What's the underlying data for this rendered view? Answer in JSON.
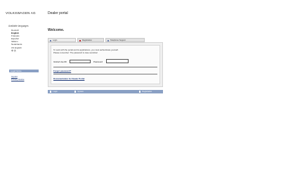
{
  "header": {
    "brand": "VOLKSWAGEN AG",
    "page_title": "Dealer portal",
    "welcome": "Welcome."
  },
  "sidebar": {
    "languages_title": "Available languages",
    "languages": [
      {
        "label": "Deutsch",
        "selected": false
      },
      {
        "label": "English",
        "selected": true
      },
      {
        "label": "Français",
        "selected": false
      },
      {
        "label": "Español",
        "selected": false
      },
      {
        "label": "Italiano",
        "selected": false
      },
      {
        "label": "Nederlands",
        "selected": false
      },
      {
        "label": "US English",
        "selected": false
      }
    ],
    "language_extra": "中 文",
    "box_title": "Legal Notice",
    "links": [
      "Imprint",
      "Privacy Notice"
    ]
  },
  "tabs": [
    {
      "label": "Login",
      "active": true,
      "dot_color": "#6a7fb0"
    },
    {
      "label": "Registration",
      "active": false,
      "dot_color": "#c0272d"
    },
    {
      "label": "Telephone Support",
      "active": false,
      "dot_color": "#6a7fb0"
    }
  ],
  "login": {
    "message_line1": "To work with the portal and its applications, you must authenticate yourself.",
    "message_line2": "Please remember: The password is case sensitive!",
    "userid_label": "Global UserID",
    "userid_value": "",
    "password_label": "Password",
    "password_value": "",
    "forgot_password": "Forgot password?",
    "documentation": "Documentation for Dealer Portal"
  },
  "bottom_bar": {
    "items": [
      "Login",
      "System",
      "Registration"
    ]
  },
  "colors": {
    "accent": "#8aa0c4",
    "link": "#1f3b7a",
    "registration_dot": "#c0272d"
  }
}
